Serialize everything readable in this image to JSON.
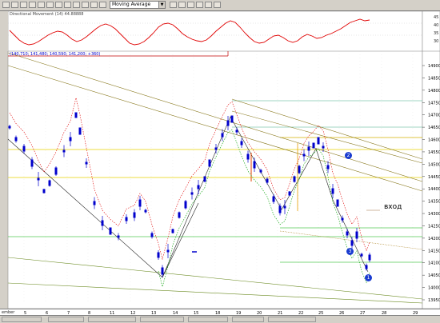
{
  "toolbar": {
    "indicator_select": "Moving Average",
    "colors": {
      "bg": "#d4d0c8"
    }
  },
  "indicator_panel": {
    "title": "Directional Movement (14) 44.88888",
    "scale": [
      "45",
      "40",
      "35",
      "30"
    ]
  },
  "price_panel": {
    "title": "(140,710; 141,480; 140,590; 141,200; +360)",
    "price_scale": [
      "14900",
      "14850",
      "14800",
      "14750",
      "14700",
      "14650",
      "14600",
      "14550",
      "14500",
      "14450",
      "14400",
      "14350",
      "14300",
      "14250",
      "14200",
      "14150",
      "14100",
      "14050",
      "14000",
      "13950"
    ],
    "annotations": {
      "entry": "вход",
      "wave2": "2",
      "wave3": "3",
      "wave1": "1"
    }
  },
  "date_axis": {
    "labels": [
      "5",
      "6",
      "7",
      "8",
      "11",
      "12",
      "13",
      "14",
      "15",
      "18",
      "19",
      "20",
      "21",
      "22",
      "25",
      "26",
      "27",
      "28",
      "29"
    ],
    "month": "ember"
  },
  "colors": {
    "candle": "#0000cc",
    "ma_red": "#e00000",
    "ma_green": "#00a000",
    "panel_bg": "#ffffff"
  }
}
